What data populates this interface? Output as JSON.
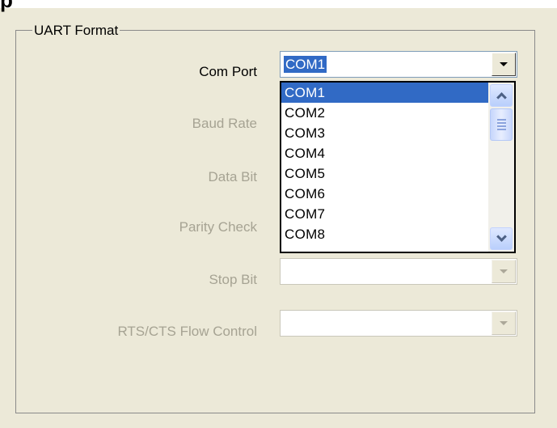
{
  "header": {
    "partial_text": "p"
  },
  "group": {
    "title": "UART Format"
  },
  "fields": [
    {
      "label": "Com Port",
      "enabled": true,
      "value": "COM1"
    },
    {
      "label": "Baud Rate",
      "enabled": false
    },
    {
      "label": "Data Bit",
      "enabled": false
    },
    {
      "label": "Parity Check",
      "enabled": false
    },
    {
      "label": "Stop Bit",
      "enabled": false,
      "value": ""
    },
    {
      "label": "RTS/CTS Flow Control",
      "enabled": false,
      "value": ""
    }
  ],
  "dropdown": {
    "selected": "COM1",
    "options": [
      "COM1",
      "COM2",
      "COM3",
      "COM4",
      "COM5",
      "COM6",
      "COM7",
      "COM8"
    ],
    "scroll_position": 0
  },
  "colors": {
    "background": "#ece9d8",
    "selection": "#316ac5",
    "disabled_text": "#a6a393"
  }
}
